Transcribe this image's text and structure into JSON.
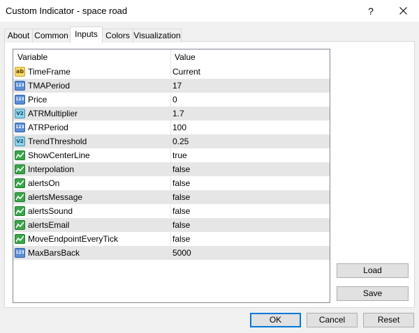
{
  "window": {
    "title": "Custom Indicator - space road",
    "help_glyph": "?",
    "close_icon": "close-icon"
  },
  "tabs": [
    {
      "label": "About"
    },
    {
      "label": "Common"
    },
    {
      "label": "Inputs",
      "active": true
    },
    {
      "label": "Colors"
    },
    {
      "label": "Visualization"
    }
  ],
  "grid": {
    "headers": {
      "variable": "Variable",
      "value": "Value"
    },
    "rows": [
      {
        "icon": "string-type-icon",
        "type_glyph": "ab",
        "kind": "ab",
        "name": "TimeFrame",
        "value": "Current"
      },
      {
        "icon": "integer-type-icon",
        "type_glyph": "123",
        "kind": "num",
        "name": "TMAPeriod",
        "value": "17"
      },
      {
        "icon": "integer-type-icon",
        "type_glyph": "123",
        "kind": "num",
        "name": "Price",
        "value": "0"
      },
      {
        "icon": "double-type-icon",
        "type_glyph": "V2",
        "kind": "dbl",
        "name": "ATRMultiplier",
        "value": "1.7"
      },
      {
        "icon": "integer-type-icon",
        "type_glyph": "123",
        "kind": "num",
        "name": "ATRPeriod",
        "value": "100"
      },
      {
        "icon": "double-type-icon",
        "type_glyph": "V2",
        "kind": "dbl",
        "name": "TrendThreshold",
        "value": "0.25"
      },
      {
        "icon": "bool-type-icon",
        "type_glyph": "",
        "kind": "bool",
        "name": "ShowCenterLine",
        "value": "true"
      },
      {
        "icon": "bool-type-icon",
        "type_glyph": "",
        "kind": "bool",
        "name": "Interpolation",
        "value": "false"
      },
      {
        "icon": "bool-type-icon",
        "type_glyph": "",
        "kind": "bool",
        "name": "alertsOn",
        "value": "false"
      },
      {
        "icon": "bool-type-icon",
        "type_glyph": "",
        "kind": "bool",
        "name": "alertsMessage",
        "value": "false"
      },
      {
        "icon": "bool-type-icon",
        "type_glyph": "",
        "kind": "bool",
        "name": "alertsSound",
        "value": "false"
      },
      {
        "icon": "bool-type-icon",
        "type_glyph": "",
        "kind": "bool",
        "name": "alertsEmail",
        "value": "false"
      },
      {
        "icon": "bool-type-icon",
        "type_glyph": "",
        "kind": "bool",
        "name": "MoveEndpointEveryTick",
        "value": "false"
      },
      {
        "icon": "integer-type-icon",
        "type_glyph": "123",
        "kind": "num",
        "name": "MaxBarsBack",
        "value": "5000"
      }
    ]
  },
  "side_buttons": {
    "load": "Load",
    "save": "Save"
  },
  "footer_buttons": {
    "ok": "OK",
    "cancel": "Cancel",
    "reset": "Reset"
  },
  "colors": {
    "accent": "#0078d7",
    "row_alt": "#e6e6e6",
    "border": "#828790"
  }
}
